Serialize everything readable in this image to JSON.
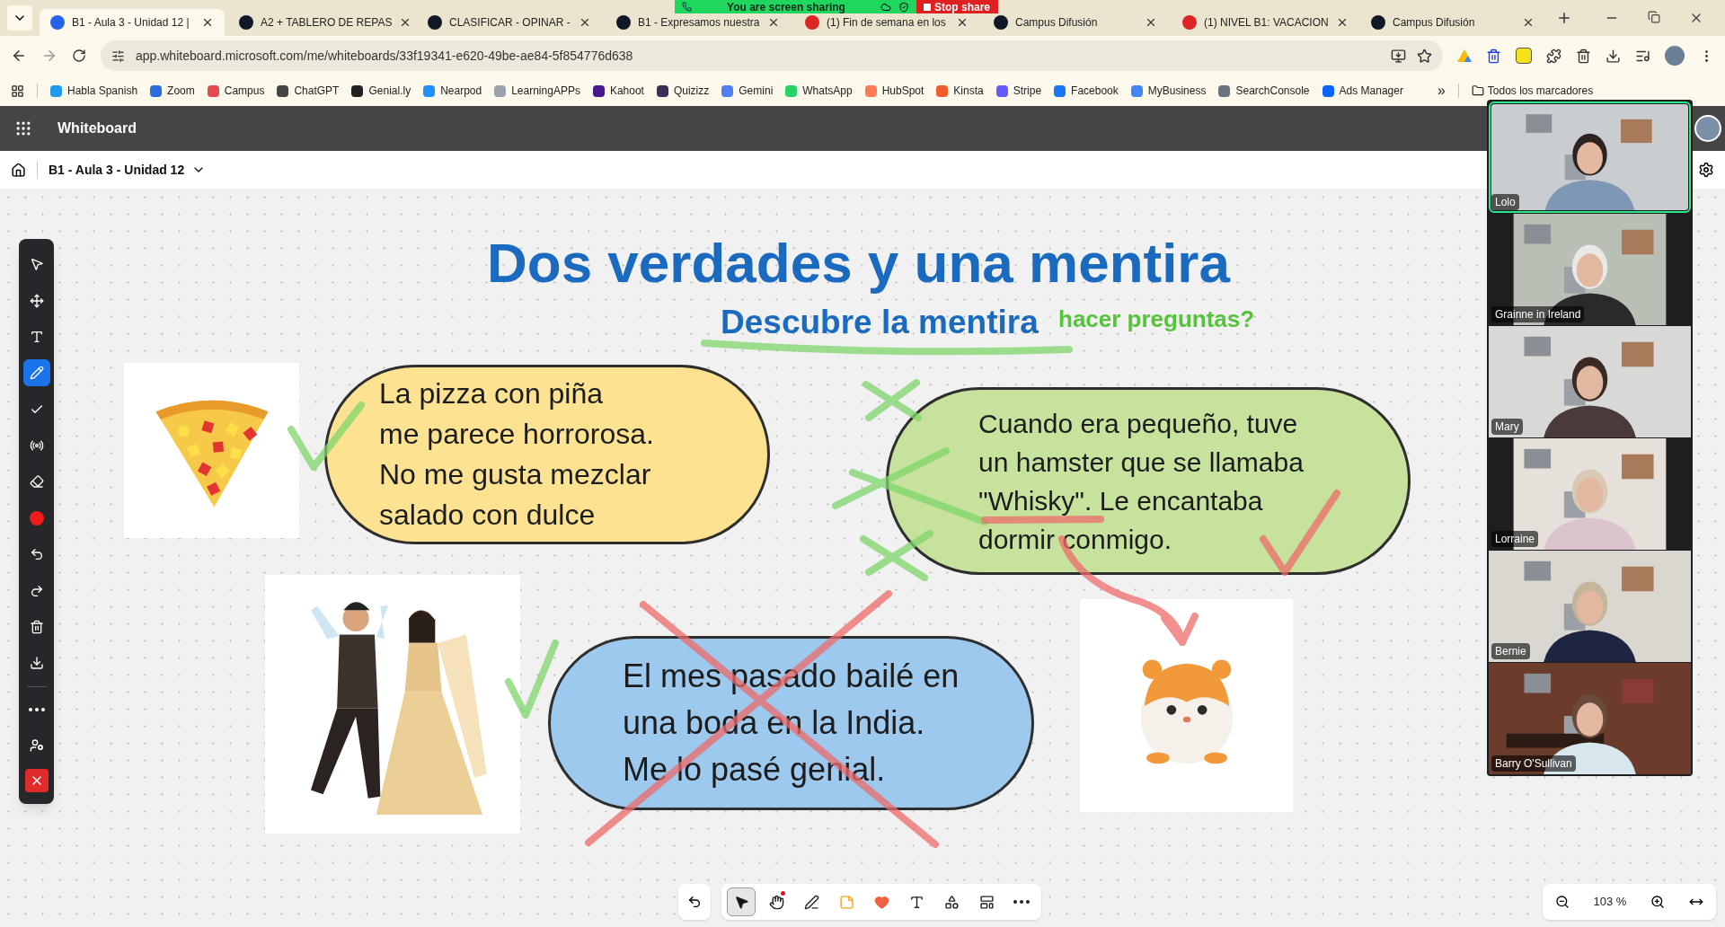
{
  "browser": {
    "tabs": [
      {
        "title": "B1 - Aula 3 - Unidad 12 |",
        "selected": true
      },
      {
        "title": "A2 + TABLERO DE REPAS",
        "selected": false
      },
      {
        "title": "CLASIFICAR - OPINAR -",
        "selected": false
      },
      {
        "title": "B1 - Expresamos nuestra",
        "selected": false
      },
      {
        "title": "(1) Fin de semana en los",
        "selected": false
      },
      {
        "title": "Campus Difusión",
        "selected": false
      },
      {
        "title": "(1) NIVEL B1: VACACION",
        "selected": false
      },
      {
        "title": "Campus Difusión",
        "selected": false
      }
    ],
    "address": "app.whiteboard.microsoft.com/me/whiteboards/33f19341-e620-49be-ae84-5f854776d638",
    "bookmarks": [
      "Habla Spanish",
      "Zoom",
      "Campus",
      "ChatGPT",
      "Genial.ly",
      "Nearpod",
      "LearningAPPs",
      "Kahoot",
      "Quizizz",
      "Gemini",
      "WhatsApp",
      "HubSpot",
      "Kinsta",
      "Stripe",
      "Facebook",
      "MyBusiness",
      "SearchConsole",
      "Ads Manager"
    ],
    "bookmarks_overflow": "»",
    "all_bookmarks": "Todos los marcadores"
  },
  "share_banner": {
    "status": "You are screen sharing",
    "stop": "Stop share"
  },
  "app": {
    "name": "Whiteboard",
    "board_title": "B1 - Aula 3 - Unidad 12"
  },
  "board": {
    "title": "Dos verdades y una mentira",
    "subtitle": "Descubre la mentira",
    "note": "hacer preguntas?",
    "cards": [
      {
        "color": "#fde391",
        "lines": [
          "La pizza con piña",
          "me parece horrorosa.",
          "No me gusta mezclar",
          "salado con dulce"
        ]
      },
      {
        "color": "#c6e29c",
        "lines": [
          "Cuando era pequeño, tuve",
          "un hamster que se llamaba",
          "\"Whisky\". Le encantaba",
          "dormir conmigo."
        ]
      },
      {
        "color": "#9dc9ee",
        "lines": [
          "El mes pasado bailé en",
          "una boda en la India.",
          "Me lo pasé genial."
        ]
      }
    ]
  },
  "left_toolbar": [
    {
      "kind": "pointer",
      "selected": false
    },
    {
      "kind": "move",
      "selected": false
    },
    {
      "kind": "text",
      "selected": false
    },
    {
      "kind": "pen",
      "selected": true
    },
    {
      "kind": "check",
      "selected": false
    },
    {
      "kind": "laser",
      "selected": false
    },
    {
      "kind": "eraser",
      "selected": false
    },
    {
      "kind": "color",
      "selected": false
    },
    {
      "kind": "undo",
      "selected": false
    },
    {
      "kind": "redo",
      "selected": false
    },
    {
      "kind": "delete",
      "selected": false
    },
    {
      "kind": "download",
      "selected": false
    },
    {
      "kind": "more",
      "selected": false
    },
    {
      "kind": "user",
      "selected": false
    },
    {
      "kind": "close",
      "selected": false
    }
  ],
  "bottom_toolbar": [
    {
      "kind": "select",
      "selected": true
    },
    {
      "kind": "hand",
      "selected": false
    },
    {
      "kind": "pen",
      "selected": false
    },
    {
      "kind": "sticky",
      "selected": false
    },
    {
      "kind": "reaction",
      "selected": false
    },
    {
      "kind": "text",
      "selected": false
    },
    {
      "kind": "shapes",
      "selected": false
    },
    {
      "kind": "templates",
      "selected": false
    },
    {
      "kind": "more",
      "selected": false
    }
  ],
  "zoom": "103 %",
  "participants": [
    {
      "name": "Lolo",
      "speaking": true
    },
    {
      "name": "Grainne in Ireland",
      "speaking": false
    },
    {
      "name": "Mary",
      "speaking": false
    },
    {
      "name": "Lorraine",
      "speaking": false
    },
    {
      "name": "Bernie",
      "speaking": false
    },
    {
      "name": "Barry O'Sullivan",
      "speaking": false
    }
  ]
}
